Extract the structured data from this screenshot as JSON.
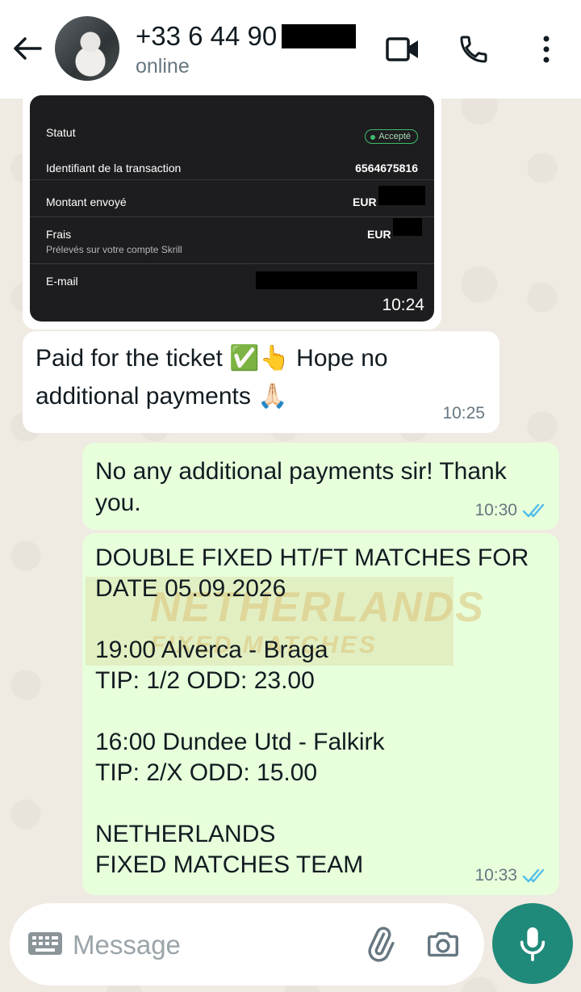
{
  "header": {
    "contact_name": "+33 6 44 90",
    "status": "online"
  },
  "receipt": {
    "status_label": "Statut",
    "status_value": "Accepté",
    "tx_label": "Identifiant de la transaction",
    "tx_value": "6564675816",
    "amount_label": "Montant envoyé",
    "amount_currency": "EUR",
    "fees_label": "Frais",
    "fees_sub": "Prélevés sur votre compte Skrill",
    "fees_currency": "EUR",
    "email_label": "E-mail",
    "time": "10:24"
  },
  "messages": [
    {
      "text": "Paid for the ticket ✅👆 Hope no additional payments 🙏🏻",
      "time": "10:25"
    },
    {
      "text": "No any additional payments sir! Thank you.",
      "time": "10:30"
    },
    {
      "lines": [
        "DOUBLE FIXED HT/FT MATCHES FOR",
        "DATE 05.09.2026",
        "",
        "19:00  Alverca - Braga",
        "TIP: 1/2  ODD: 23.00",
        "",
        "16:00  Dundee Utd - Falkirk",
        "TIP: 2/X  ODD: 15.00",
        "",
        "NETHERLANDS",
        "FIXED MATCHES TEAM"
      ],
      "time": "10:33"
    }
  ],
  "watermark": {
    "line1": "NETHERLANDS",
    "line2": "FIXED MATCHES"
  },
  "composer": {
    "placeholder": "Message"
  },
  "colors": {
    "accent": "#1f8a7a",
    "outgoing": "#e7ffdb",
    "read_ticks": "#53bdeb"
  },
  "icons": [
    "back-arrow-icon",
    "video-call-icon",
    "phone-icon",
    "more-vert-icon",
    "keyboard-icon",
    "attach-icon",
    "camera-icon",
    "mic-icon",
    "double-check-icon"
  ]
}
